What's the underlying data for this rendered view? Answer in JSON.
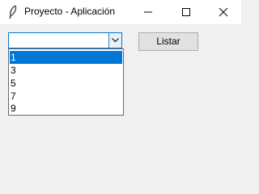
{
  "window": {
    "title": "Proyecto - Aplicación",
    "icon": "feather-icon"
  },
  "titlebar_buttons": {
    "minimize_icon": "minimize-icon",
    "maximize_icon": "maximize-icon",
    "close_icon": "close-icon"
  },
  "combobox": {
    "value": "",
    "arrow_icon": "chevron-down-icon",
    "options": [
      "1",
      "3",
      "5",
      "7",
      "9"
    ],
    "highlighted": "1"
  },
  "buttons": {
    "listar_label": "Listar"
  },
  "colors": {
    "selection": "#0078d7",
    "focus_border": "#0078d7",
    "background": "#f0f0f0"
  }
}
